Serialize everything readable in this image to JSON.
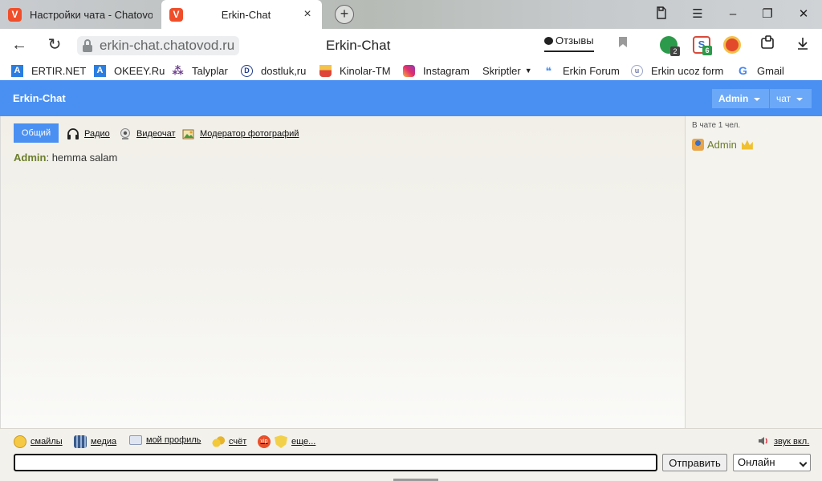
{
  "browser": {
    "tabs": [
      {
        "title": "Настройки чата - Chatovod",
        "active": false
      },
      {
        "title": "Erkin-Chat",
        "active": true
      }
    ],
    "url": "erkin-chat.chatovod.ru",
    "page_title": "Erkin-Chat",
    "feedback_label": "Отзывы",
    "extensions": [
      {
        "name": "shield-extension-icon",
        "badge": "2",
        "color": "#2b9a4a"
      },
      {
        "name": "s-extension-icon",
        "badge": "6",
        "color": "#d94a3a"
      },
      {
        "name": "record-extension-icon",
        "badge": "",
        "color": "#e34a2c"
      }
    ],
    "bookmarks": [
      {
        "label": "ERTIR.NET",
        "icon": "a-letter-icon"
      },
      {
        "label": "OKEEY.Ru",
        "icon": "a-letter-icon"
      },
      {
        "label": "Talyplar",
        "icon": "grapes-icon"
      },
      {
        "label": "dostluk,ru",
        "icon": "d-circle-icon"
      },
      {
        "label": "Kinolar-TM",
        "icon": "popcorn-icon"
      },
      {
        "label": "Instagram",
        "icon": "instagram-icon"
      },
      {
        "label": "Skriptler",
        "icon": "folder-dropdown-icon"
      },
      {
        "label": "Erkin Forum",
        "icon": "chat-bubbles-icon"
      },
      {
        "label": "Erkin ucoz form",
        "icon": "ucoz-icon"
      },
      {
        "label": "Gmail",
        "icon": "google-icon"
      }
    ]
  },
  "chat": {
    "brand": "Erkin-Chat",
    "header_menus": {
      "admin": "Admin",
      "chat": "чат"
    },
    "room_tab": "Общий",
    "top_links": [
      {
        "label": "Радио",
        "icon": "headphones-icon"
      },
      {
        "label": "Видеочат",
        "icon": "webcam-icon"
      },
      {
        "label": "Модератор фотографий",
        "icon": "photo-moderator-icon"
      }
    ],
    "messages": [
      {
        "nick": "Admin",
        "separator": ":",
        "text": "hemma salam"
      }
    ],
    "sidebar": {
      "count_text": "В чате 1 чел.",
      "users": [
        {
          "name": "Admin",
          "role": "crown-icon"
        }
      ]
    },
    "bottom_links": [
      {
        "label": "смайлы",
        "icon": "smiley-icon"
      },
      {
        "label": "медиа",
        "icon": "film-icon"
      },
      {
        "label": "мой профиль",
        "icon": "profile-card-icon"
      },
      {
        "label": "счёт",
        "icon": "coins-icon"
      },
      {
        "label": "еще...",
        "icon": "vip-shield-icon"
      }
    ],
    "sound_label": "звук вкл.",
    "input": {
      "value": "",
      "placeholder": ""
    },
    "send_label": "Отправить",
    "status_value": "Онлайн"
  },
  "colors": {
    "accent": "#4a90f2",
    "nick": "#6b7d2a",
    "brand_logo": "#f04e2a"
  }
}
